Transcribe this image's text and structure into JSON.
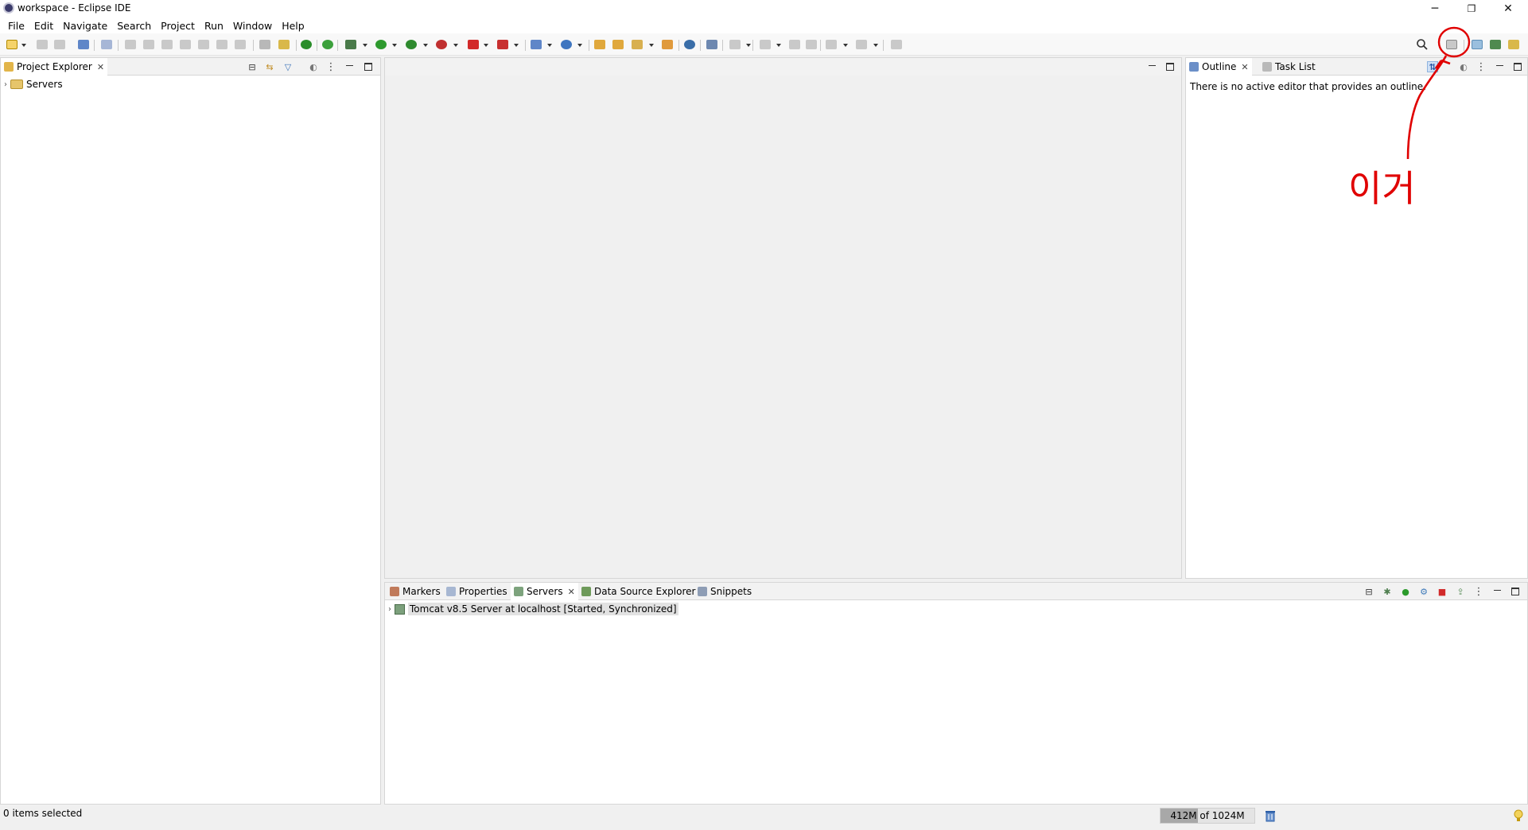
{
  "window": {
    "title": "workspace - Eclipse IDE",
    "controls": {
      "minimize": "─",
      "restore": "❐",
      "close": "✕"
    }
  },
  "menu": [
    "File",
    "Edit",
    "Navigate",
    "Search",
    "Project",
    "Run",
    "Window",
    "Help"
  ],
  "project_explorer": {
    "tab_label": "Project Explorer",
    "tree": [
      {
        "label": "Servers",
        "expanded": false
      }
    ]
  },
  "outline": {
    "tab_label": "Outline",
    "second_tab_label": "Task List",
    "message": "There is no active editor that provides an outline."
  },
  "bottom_panel": {
    "tabs": [
      "Markers",
      "Properties",
      "Servers",
      "Data Source Explorer",
      "Snippets"
    ],
    "active_tab": "Servers",
    "server_row": "Tomcat v8.5 Server at localhost  [Started, Synchronized]"
  },
  "status": {
    "selection": "0 items selected",
    "heap": "412M of 1024M",
    "heap_fraction": 0.402
  },
  "annotation": {
    "text": "이거",
    "color": "#e00000"
  }
}
